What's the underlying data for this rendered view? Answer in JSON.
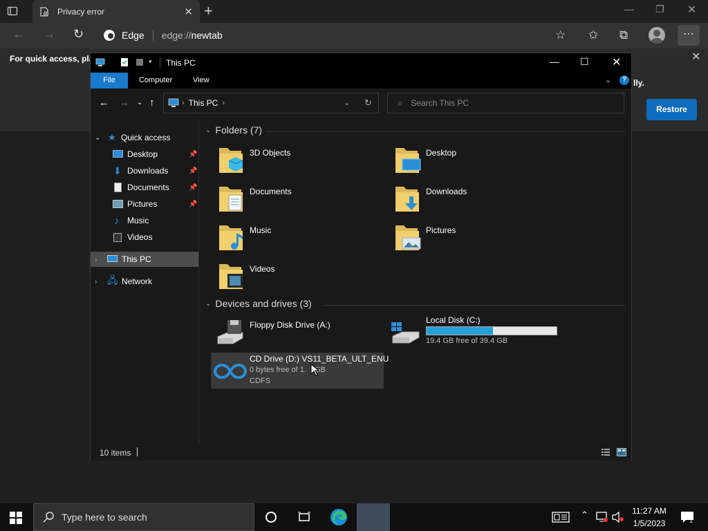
{
  "browser": {
    "tab_title": "Privacy error",
    "brand": "Edge",
    "url_prefix": "edge://",
    "url_host": "newtab",
    "infobar_text": "For quick access, plac",
    "infobar_text_tail": "lly.",
    "restore_label": "Restore"
  },
  "explorer": {
    "title": "This PC",
    "ribbon_tabs": [
      "File",
      "Computer",
      "View"
    ],
    "breadcrumb": "This PC",
    "search_placeholder": "Search This PC",
    "nav": {
      "quick_access": "Quick access",
      "items": [
        "Desktop",
        "Downloads",
        "Documents",
        "Pictures",
        "Music",
        "Videos"
      ],
      "this_pc": "This PC",
      "network": "Network"
    },
    "folders_header": "Folders (7)",
    "folders": [
      "3D Objects",
      "Desktop",
      "Documents",
      "Downloads",
      "Music",
      "Pictures",
      "Videos"
    ],
    "devices_header": "Devices and drives (3)",
    "drives": {
      "floppy": {
        "name": "Floppy Disk Drive (A:)"
      },
      "c": {
        "name": "Local Disk (C:)",
        "free": "19.4 GB free of 39.4 GB",
        "used_fraction": 0.51
      },
      "d": {
        "name": "CD Drive (D:) VS11_BETA_ULT_ENU",
        "free": "0 bytes free of 1.",
        "free_tail": "GB",
        "fs": "CDFS"
      }
    },
    "status": "10 items"
  },
  "taskbar": {
    "search_placeholder": "Type here to search",
    "time": "11:27 AM",
    "date": "1/5/2023"
  },
  "colors": {
    "accent": "#1979ca",
    "restore_button": "#0f6cbd",
    "disk_bar": "#26a0da"
  }
}
